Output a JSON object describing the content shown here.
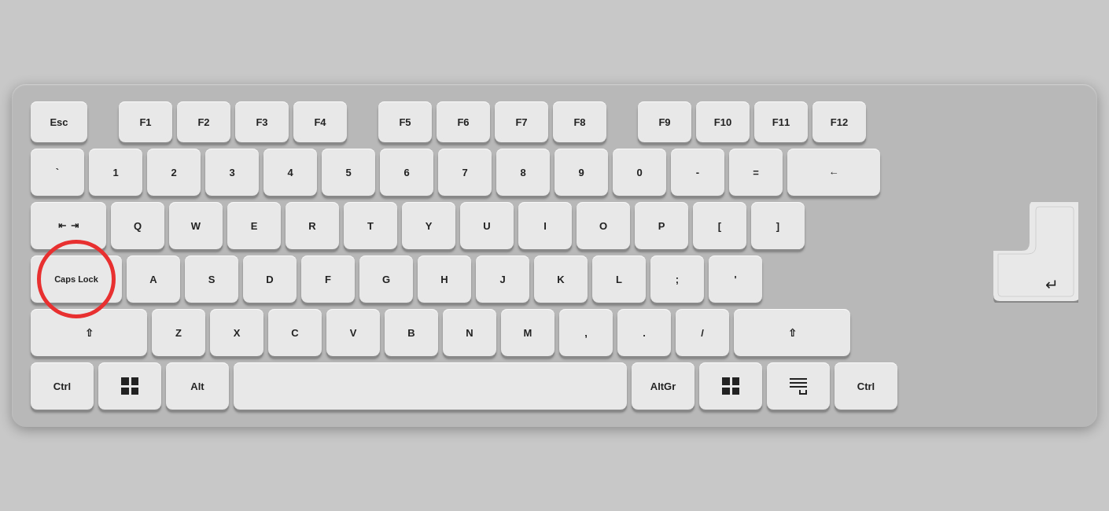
{
  "keyboard": {
    "background": "#b8b8b8",
    "rows": {
      "fn": [
        "Esc",
        "F1",
        "F2",
        "F3",
        "F4",
        "F5",
        "F6",
        "F7",
        "F8",
        "F9",
        "F10",
        "F11",
        "F12"
      ],
      "number": [
        "`",
        "1",
        "2",
        "3",
        "4",
        "5",
        "6",
        "7",
        "8",
        "9",
        "0",
        "-",
        "="
      ],
      "tab": [
        "Tab",
        "Q",
        "W",
        "E",
        "R",
        "T",
        "Y",
        "U",
        "I",
        "O",
        "P",
        "[",
        "]",
        "\\"
      ],
      "caps": [
        "Caps Lock",
        "A",
        "S",
        "D",
        "F",
        "G",
        "H",
        "J",
        "K",
        "L",
        ";",
        "'"
      ],
      "shift": [
        "⇧",
        "Z",
        "X",
        "C",
        "V",
        "B",
        "N",
        "M",
        ",",
        ".",
        "/",
        "⇧"
      ],
      "bottom": [
        "Ctrl",
        "Win",
        "Alt",
        " ",
        "AltGr",
        "Win",
        "Menu",
        "Ctrl"
      ]
    },
    "caps_lock_highlighted": true,
    "highlight_color": "#e83030"
  }
}
